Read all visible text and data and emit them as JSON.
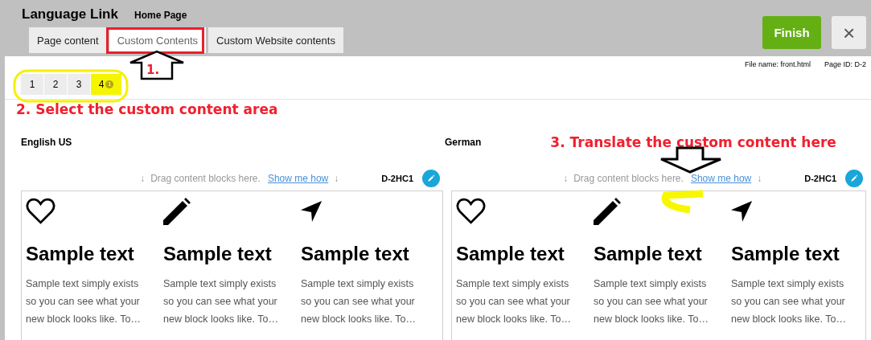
{
  "header": {
    "title": "Language Link",
    "subtitle": "Home Page",
    "finish": "Finish",
    "close": "×"
  },
  "tabs": [
    {
      "label": "Page content",
      "selected": false
    },
    {
      "label": "Custom Contents",
      "selected": true
    },
    {
      "label": "Custom Website contents",
      "selected": false
    }
  ],
  "file_name": "File name: front.html",
  "page_id": "Page ID: D-2",
  "areas": [
    {
      "label": "1",
      "selected": false
    },
    {
      "label": "2",
      "selected": false
    },
    {
      "label": "3",
      "selected": false
    },
    {
      "label": "4",
      "selected": true,
      "badge": "1"
    }
  ],
  "annotations": [
    "1.",
    "2. Select the custom content area",
    "3. Translate the custom content here"
  ],
  "columns": [
    {
      "language": "English US",
      "arrow_left": "↓",
      "hint": "Drag content blocks here.",
      "link": "Show me how",
      "arrow_right": "↓",
      "block_id": "D-2HC1",
      "items": [
        {
          "kind": "heart",
          "title": "Sample text",
          "body": "Sample text simply exists so you can see what your new block looks like. To…"
        },
        {
          "kind": "pencil",
          "title": "Sample text",
          "body": "Sample text simply exists so you can see what your new block looks like. To…"
        },
        {
          "kind": "send",
          "title": "Sample text",
          "body": "Sample text simply exists so you can see what your new block looks like. To…"
        }
      ]
    },
    {
      "language": "German",
      "arrow_left": "↓",
      "hint": "Drag content blocks here.",
      "link": "Show me how",
      "arrow_right": "↓",
      "block_id": "D-2HC1",
      "items": [
        {
          "kind": "heart",
          "title": "Sample text",
          "body": "Sample text simply exists so you can see what your new block looks like. To…"
        },
        {
          "kind": "pencil",
          "title": "Sample text",
          "body": "Sample text simply exists so you can see what your new block looks like. To…"
        },
        {
          "kind": "send",
          "title": "Sample text",
          "body": "Sample text simply exists so you can see what your new block looks like. To…"
        }
      ]
    }
  ]
}
